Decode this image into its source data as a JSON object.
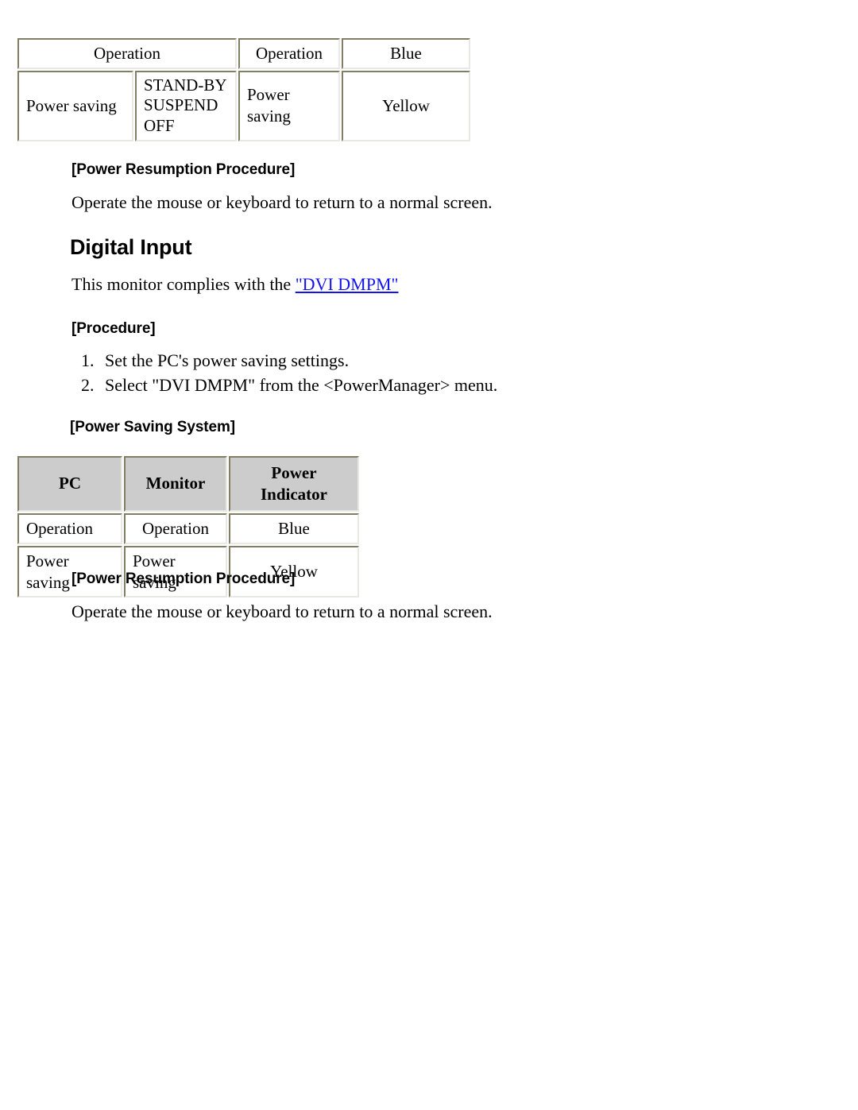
{
  "document": {
    "tables": [
      {
        "name": "analog-power-saving-table",
        "rows": [
          {
            "cells": [
              {
                "text": "Operation",
                "colspan": 2,
                "align": "center"
              },
              {
                "text": "Operation",
                "colspan": 1,
                "align": "center"
              },
              {
                "text": "Blue",
                "colspan": 1,
                "align": "center"
              }
            ]
          },
          {
            "cells": [
              {
                "text": "Power saving",
                "colspan": 1,
                "align": "left"
              },
              {
                "text": "STAND-BY\nSUSPEND\nOFF",
                "colspan": 1,
                "align": "left"
              },
              {
                "text": "Power saving",
                "colspan": 1,
                "align": "left"
              },
              {
                "text": "Yellow",
                "colspan": 1,
                "align": "center"
              }
            ]
          }
        ],
        "row2": {
          "pc": "Power saving",
          "states": [
            "STAND-BY",
            "SUSPEND",
            "OFF"
          ],
          "monitor": "Power saving",
          "indicator": "Yellow"
        },
        "row1": {
          "pc_monitor": "Operation",
          "monitor": "Operation",
          "indicator": "Blue"
        }
      },
      {
        "name": "digital-power-saving-table",
        "headers": [
          "PC",
          "Monitor",
          "Power Indicator"
        ],
        "rows": [
          [
            "Operation",
            "Operation",
            "Blue"
          ],
          [
            "Power saving",
            "Power saving",
            "Yellow"
          ]
        ]
      }
    ],
    "headings": {
      "power_resumption_1": "[Power Resumption Procedure]",
      "digital_input": "Digital Input",
      "procedure": "[Procedure]",
      "power_saving_system": "[Power Saving System]",
      "power_resumption_2": "[Power Resumption Procedure]"
    },
    "paragraphs": {
      "resume_instruction_1": "Operate the mouse or keyboard to return to a normal screen.",
      "resume_instruction_2": "Operate the mouse or keyboard to return to a normal screen.",
      "complies_prefix": "This monitor complies with the ",
      "complies_link": "\"DVI DMPM\""
    },
    "procedure_steps": [
      "Set the PC's power saving settings.",
      "Select \"DVI DMPM\" from the <PowerManager> menu."
    ],
    "colors": {
      "link": "#1414ee",
      "table_border_dark": "#807f66",
      "table_border_light": "#e8e8e4",
      "header_background": "#cccccc",
      "text": "#000000",
      "page_background": "#ffffff"
    }
  }
}
